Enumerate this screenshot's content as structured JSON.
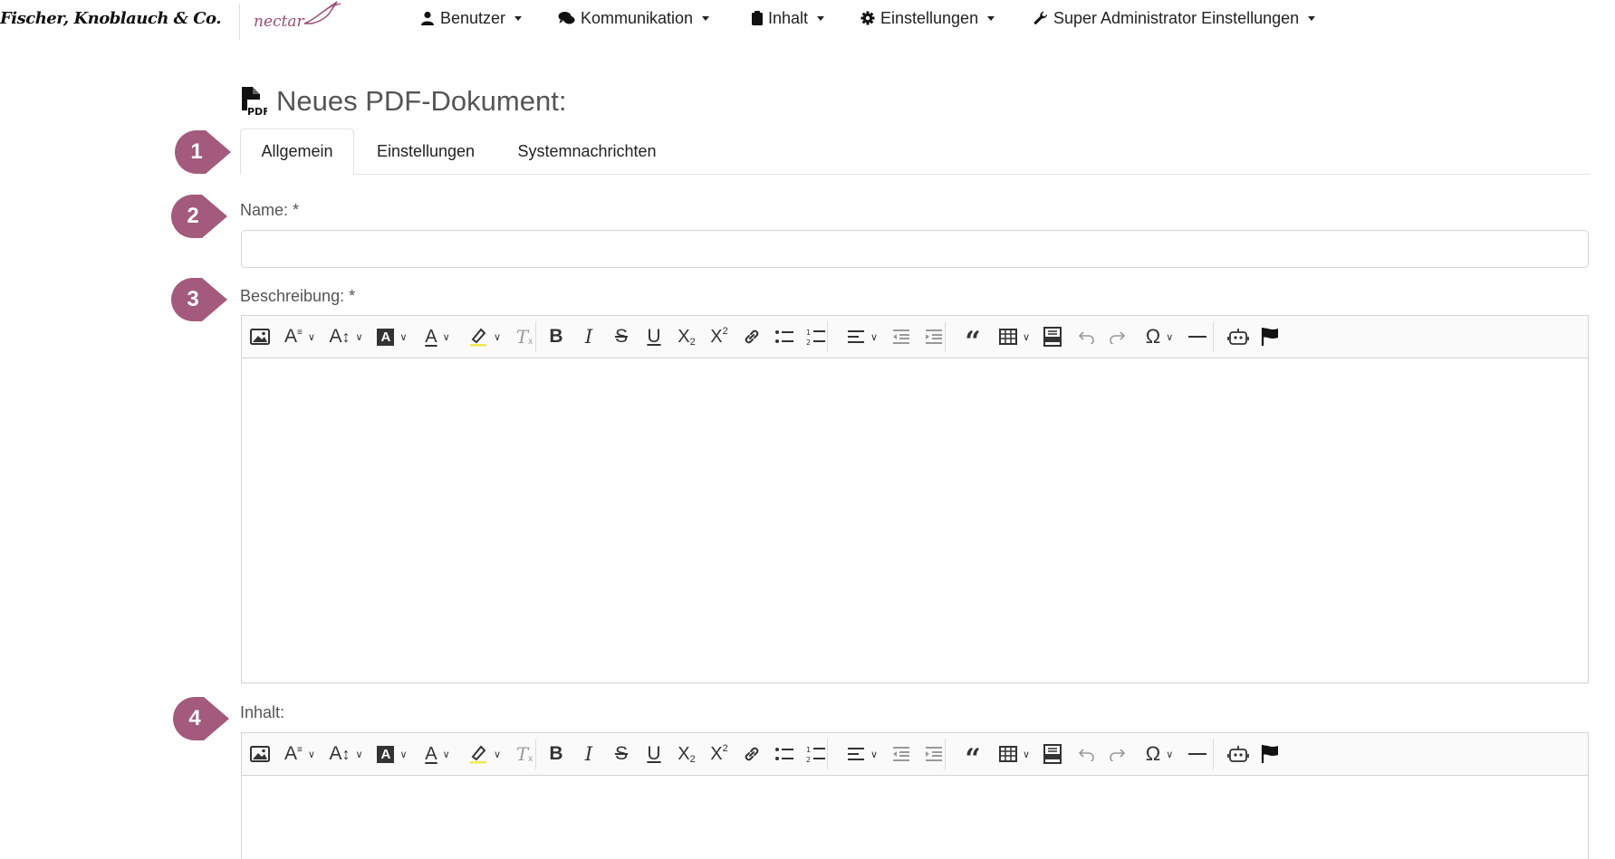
{
  "brand": {
    "company": "Fischer, Knoblauch & Co.",
    "logo_text": "nectar"
  },
  "nav": [
    {
      "label": "Benutzer",
      "icon": "user-icon"
    },
    {
      "label": "Kommunikation",
      "icon": "comments-icon"
    },
    {
      "label": "Inhalt",
      "icon": "clipboard-icon"
    },
    {
      "label": "Einstellungen",
      "icon": "gear-icon"
    },
    {
      "label": "Super Administrator Einstellungen",
      "icon": "wrench-icon"
    }
  ],
  "page": {
    "title": "Neues PDF-Dokument:",
    "icon": "file-pdf-icon"
  },
  "tabs": [
    {
      "label": "Allgemein",
      "active": true
    },
    {
      "label": "Einstellungen",
      "active": false
    },
    {
      "label": "Systemnachrichten",
      "active": false
    }
  ],
  "markers": [
    "1",
    "2",
    "3",
    "4"
  ],
  "marker_color": "#a35a7d",
  "fields": {
    "name": {
      "label": "Name: *",
      "value": "",
      "placeholder": ""
    },
    "beschreibung": {
      "label": "Beschreibung: *"
    },
    "inhalt": {
      "label": "Inhalt:"
    }
  },
  "toolbar_icons": [
    "image",
    "font-family",
    "font-size",
    "font-background-color",
    "font-color",
    "highlight",
    "remove-format",
    "bold",
    "italic",
    "strikethrough",
    "underline",
    "subscript",
    "superscript",
    "link",
    "bulleted-list",
    "numbered-list",
    "alignment",
    "outdent",
    "indent",
    "blockquote",
    "table",
    "html-embed",
    "undo",
    "redo",
    "special-characters",
    "horizontal-line",
    "ai-assistant",
    "flag"
  ]
}
